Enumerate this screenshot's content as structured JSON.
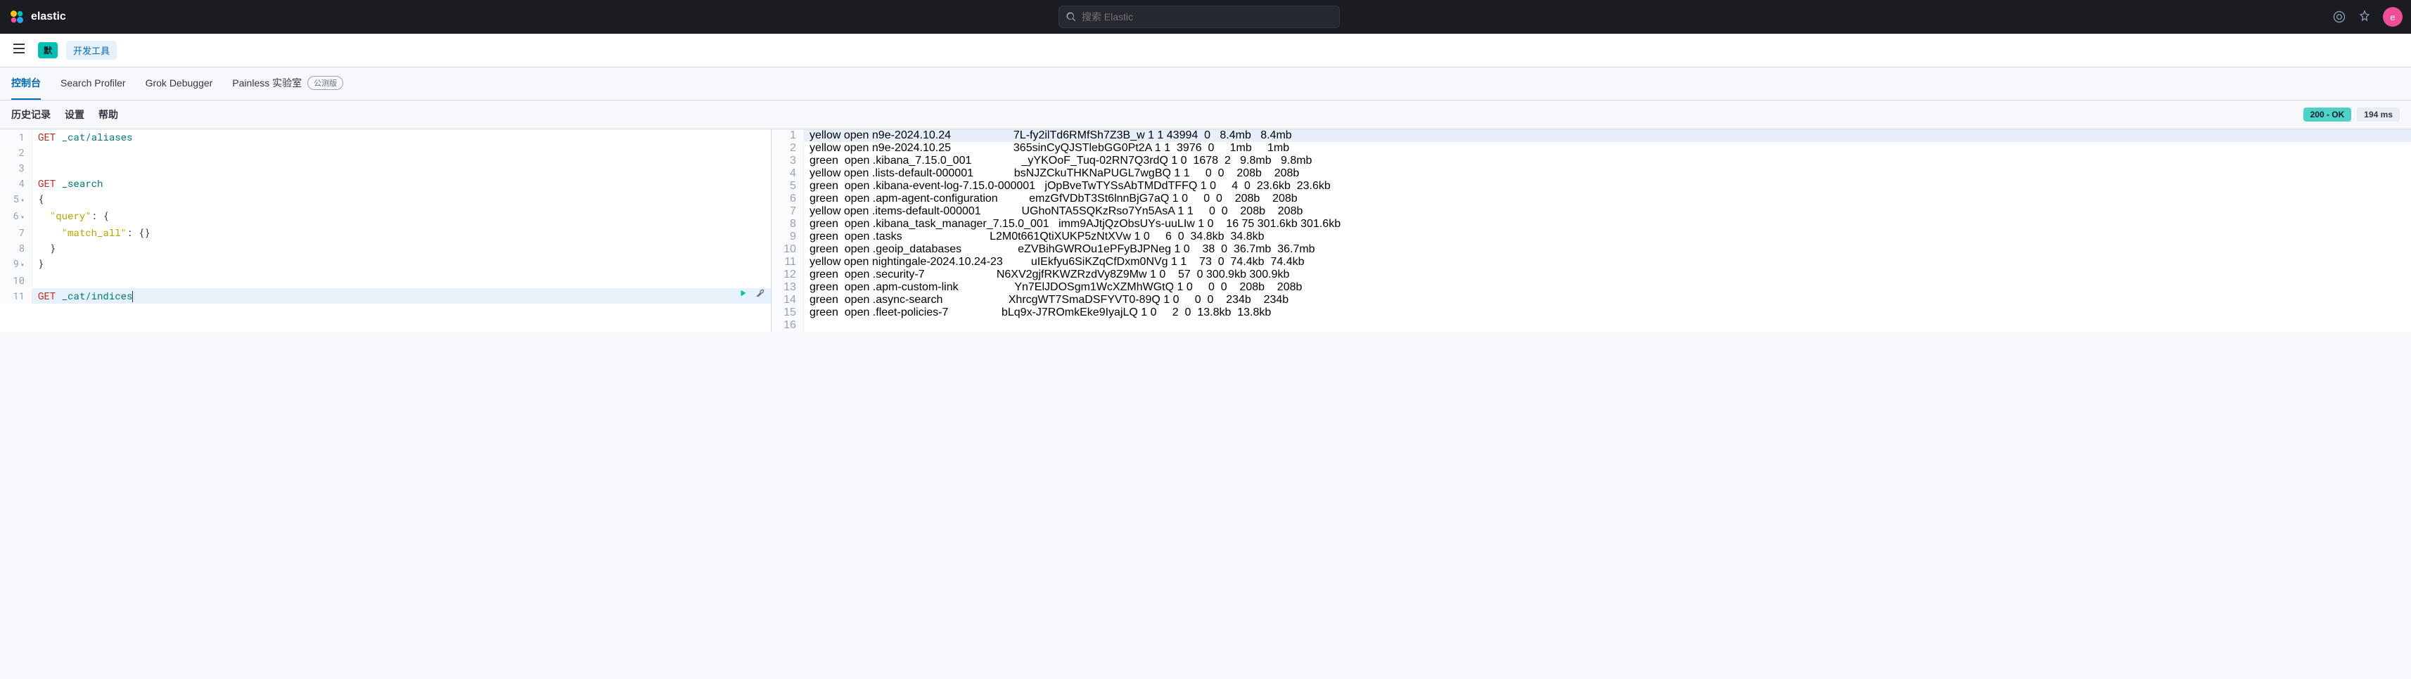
{
  "header": {
    "brand": "elastic",
    "search_placeholder": "搜索 Elastic",
    "avatar_letter": "e"
  },
  "navbar": {
    "default_badge": "默",
    "tools_label": "开发工具"
  },
  "tabs": [
    {
      "label": "控制台",
      "active": true
    },
    {
      "label": "Search Profiler",
      "active": false
    },
    {
      "label": "Grok Debugger",
      "active": false
    },
    {
      "label": "Painless 实验室",
      "active": false,
      "beta": "公测版"
    }
  ],
  "subbar": {
    "links": [
      "历史记录",
      "设置",
      "帮助"
    ],
    "status": "200 - OK",
    "time": "194 ms"
  },
  "editor": {
    "lines": [
      {
        "n": 1,
        "type": "req",
        "method": "GET",
        "path": "_cat/aliases"
      },
      {
        "n": 2,
        "type": "blank"
      },
      {
        "n": 3,
        "type": "blank"
      },
      {
        "n": 4,
        "type": "req",
        "method": "GET",
        "path": "_search"
      },
      {
        "n": 5,
        "type": "brace",
        "text": "{",
        "fold": true
      },
      {
        "n": 6,
        "type": "key",
        "indent": 1,
        "key": "\"query\"",
        "after": ": {",
        "fold": true
      },
      {
        "n": 7,
        "type": "key",
        "indent": 2,
        "key": "\"match_all\"",
        "after": ": {}"
      },
      {
        "n": 8,
        "type": "brace",
        "indent": 1,
        "text": "}"
      },
      {
        "n": 9,
        "type": "brace",
        "text": "}",
        "fold": true
      },
      {
        "n": 10,
        "type": "blank"
      },
      {
        "n": 11,
        "type": "req",
        "method": "GET",
        "path": "_cat/indices",
        "active": true,
        "actions": true
      }
    ]
  },
  "output": [
    "yellow open n9e-2024.10.24                    7L-fy2ilTd6RMfSh7Z3B_w 1 1 43994  0   8.4mb   8.4mb",
    "yellow open n9e-2024.10.25                    365sinCyQJSTlebGG0Pt2A 1 1  3976  0     1mb     1mb",
    "green  open .kibana_7.15.0_001                _yYKOoF_Tuq-02RN7Q3rdQ 1 0  1678  2   9.8mb   9.8mb",
    "yellow open .lists-default-000001             bsNJZCkuTHKNaPUGL7wgBQ 1 1     0  0    208b    208b",
    "green  open .kibana-event-log-7.15.0-000001   jOpBveTwTYSsAbTMDdTFFQ 1 0     4  0  23.6kb  23.6kb",
    "green  open .apm-agent-configuration          emzGfVDbT3St6lnnBjG7aQ 1 0     0  0    208b    208b",
    "yellow open .items-default-000001             UGhoNTA5SQKzRso7Yn5AsA 1 1     0  0    208b    208b",
    "green  open .kibana_task_manager_7.15.0_001   imm9AJtjQzObsUYs-uuLIw 1 0    16 75 301.6kb 301.6kb",
    "green  open .tasks                            L2M0t661QtiXUKP5zNtXVw 1 0     6  0  34.8kb  34.8kb",
    "green  open .geoip_databases                  eZVBihGWROu1ePFyBJPNeg 1 0    38  0  36.7mb  36.7mb",
    "yellow open nightingale-2024.10.24-23         uIEkfyu6SiKZqCfDxm0NVg 1 1    73  0  74.4kb  74.4kb",
    "green  open .security-7                       N6XV2gjfRKWZRzdVy8Z9Mw 1 0    57  0 300.9kb 300.9kb",
    "green  open .apm-custom-link                  Yn7ElJDOSgm1WcXZMhWGtQ 1 0     0  0    208b    208b",
    "green  open .async-search                     XhrcgWT7SmaDSFYVT0-89Q 1 0     0  0    234b    234b",
    "green  open .fleet-policies-7                 bLq9x-J7ROmkEke9IyajLQ 1 0     2  0  13.8kb  13.8kb",
    ""
  ]
}
